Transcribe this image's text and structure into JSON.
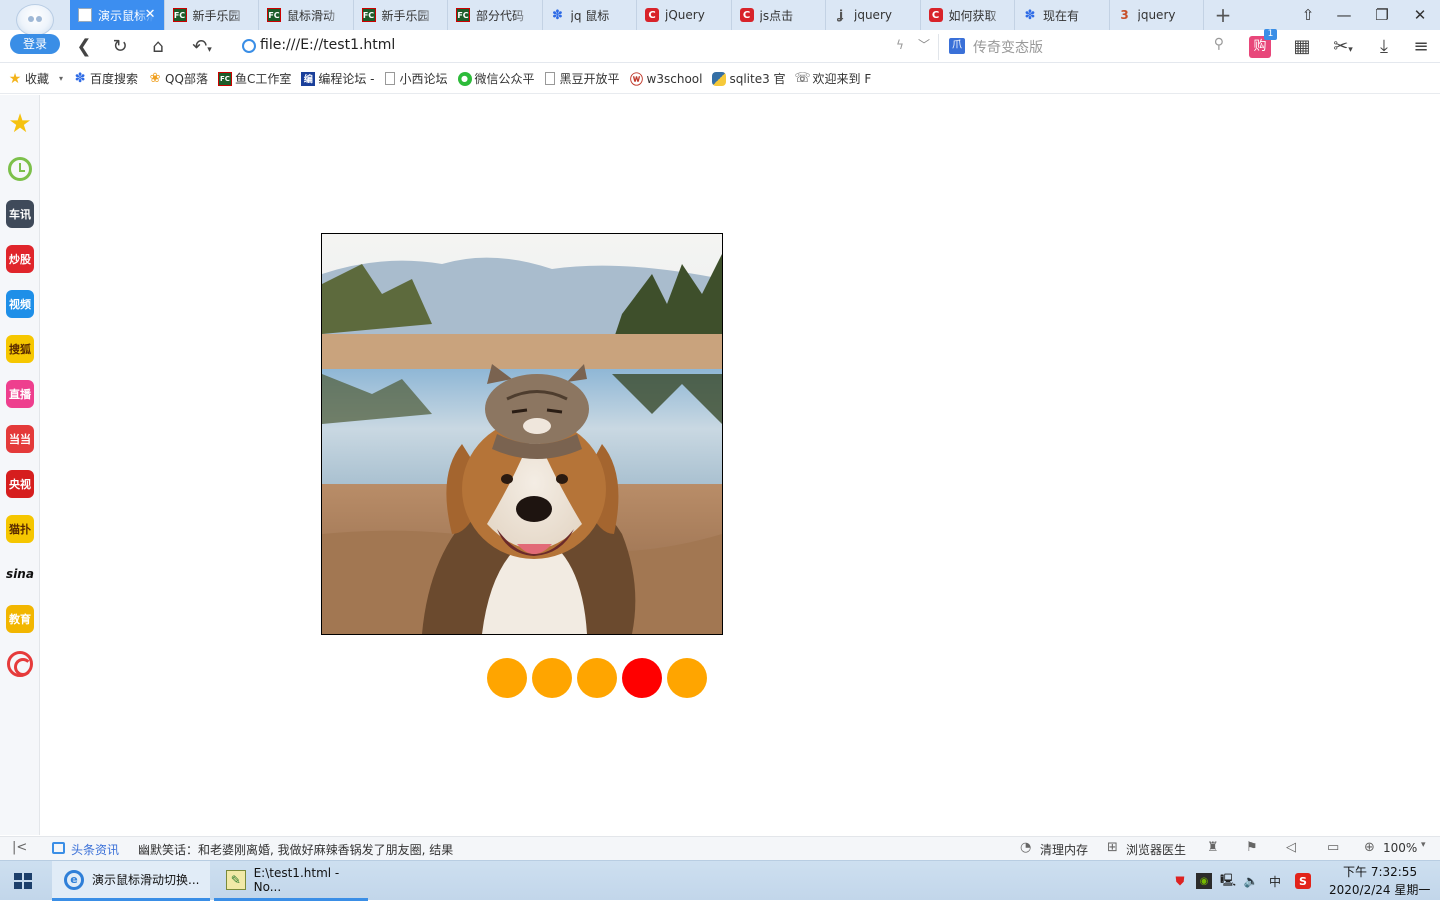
{
  "browser": {
    "login_label": "登录",
    "tabs": [
      {
        "label": "演示鼠标滑动切换",
        "icon": "page-icon",
        "active": true
      },
      {
        "label": "新手乐园",
        "icon": "fc-icon"
      },
      {
        "label": "鼠标滑动",
        "icon": "fc-icon"
      },
      {
        "label": "新手乐园",
        "icon": "fc-icon"
      },
      {
        "label": "部分代码",
        "icon": "fc-icon"
      },
      {
        "label": "jq 鼠标",
        "icon": "baidu-paw-icon"
      },
      {
        "label": "jQuery",
        "icon": "csdn-icon"
      },
      {
        "label": "js点击",
        "icon": "csdn-icon"
      },
      {
        "label": "jquery",
        "icon": "jquery-icon"
      },
      {
        "label": "如何获取",
        "icon": "csdn-icon"
      },
      {
        "label": "现在有",
        "icon": "baidu-paw-icon"
      },
      {
        "label": "jquery",
        "icon": "b3-icon"
      }
    ],
    "tab_close_symbol": "✕",
    "new_tab_symbol": "+",
    "address": "file:///E://test1.html",
    "search_placeholder": "传奇变态版",
    "shop_icon_text": "购",
    "shop_badge": "1",
    "bookmarks": [
      {
        "label": "收藏",
        "icon": "star-icon"
      },
      {
        "label": "百度搜索",
        "icon": "baidu-paw-icon"
      },
      {
        "label": "QQ部落",
        "icon": "qq-icon"
      },
      {
        "label": "鱼C工作室",
        "icon": "fc-icon"
      },
      {
        "label": "编程论坛 -",
        "icon": "bian-icon"
      },
      {
        "label": "小西论坛",
        "icon": "page-icon"
      },
      {
        "label": "微信公众平",
        "icon": "wechat-icon"
      },
      {
        "label": "黑豆开放平",
        "icon": "page-icon"
      },
      {
        "label": "w3school",
        "icon": "w3school-icon"
      },
      {
        "label": "sqlite3 官",
        "icon": "python-icon"
      },
      {
        "label": "欢迎来到 F",
        "icon": "phone-icon"
      }
    ],
    "sidebar": [
      {
        "name": "favorites",
        "text": "★",
        "bg": ""
      },
      {
        "name": "history",
        "text": "",
        "bg": ""
      },
      {
        "name": "cars",
        "text": "车讯",
        "bg": "#3f4a5a"
      },
      {
        "name": "stocks",
        "text": "炒股",
        "bg": "#e0252b"
      },
      {
        "name": "video",
        "text": "视频",
        "bg": "#1e8fe8"
      },
      {
        "name": "sohu",
        "text": "搜狐",
        "bg": "#f6c700"
      },
      {
        "name": "live",
        "text": "直播",
        "bg": "#ee3f8e"
      },
      {
        "name": "dangdang",
        "text": "当当",
        "bg": "#e43a3a"
      },
      {
        "name": "cctv",
        "text": "央视",
        "bg": "#d61e1e"
      },
      {
        "name": "maopu",
        "text": "猫扑",
        "bg": "#f5c600"
      },
      {
        "name": "sina",
        "text": "sina",
        "bg": ""
      },
      {
        "name": "education",
        "text": "教育",
        "bg": "#f2b600"
      },
      {
        "name": "phoenix",
        "text": "",
        "bg": ""
      }
    ],
    "status": {
      "news_label": "头条资讯",
      "news_text": "幽默笑话：和老婆刚离婚, 我做好麻辣香锅发了朋友圈, 结果",
      "clear_memory": "清理内存",
      "doctor": "浏览器医生",
      "zoom": "100%"
    }
  },
  "page": {
    "dots": [
      {
        "color": "#ffa500",
        "active": false
      },
      {
        "color": "#ffa500",
        "active": false
      },
      {
        "color": "#ffa500",
        "active": false
      },
      {
        "color": "#ff0000",
        "active": true
      },
      {
        "color": "#ffa500",
        "active": false
      }
    ]
  },
  "taskbar": {
    "apps": [
      {
        "label": "演示鼠标滑动切换...",
        "active": true
      },
      {
        "label": "E:\\test1.html - No...",
        "active": false
      }
    ],
    "tray_ime": "中",
    "time": "下午 7:32:55",
    "date": "2020/2/24 星期一"
  }
}
